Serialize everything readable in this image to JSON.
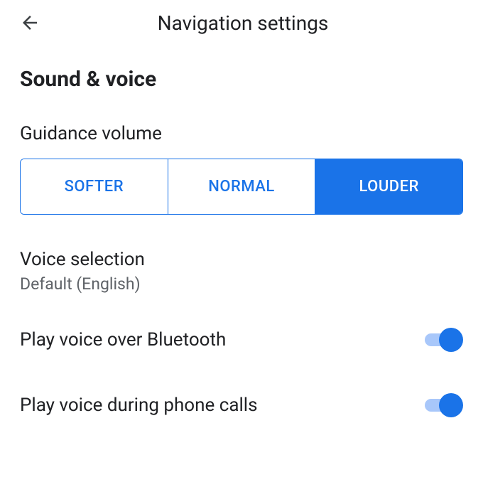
{
  "header": {
    "title": "Navigation settings"
  },
  "section": {
    "title": "Sound & voice"
  },
  "guidance": {
    "label": "Guidance volume",
    "options": {
      "softer": "SOFTER",
      "normal": "NORMAL",
      "louder": "LOUDER"
    },
    "selected": "louder"
  },
  "voice_selection": {
    "title": "Voice selection",
    "value": "Default (English)"
  },
  "bluetooth": {
    "title": "Play voice over Bluetooth",
    "enabled": true
  },
  "phone_calls": {
    "title": "Play voice during phone calls",
    "enabled": true
  },
  "colors": {
    "accent": "#1a73e8",
    "text_primary": "#202124",
    "text_secondary": "#5f6368"
  }
}
